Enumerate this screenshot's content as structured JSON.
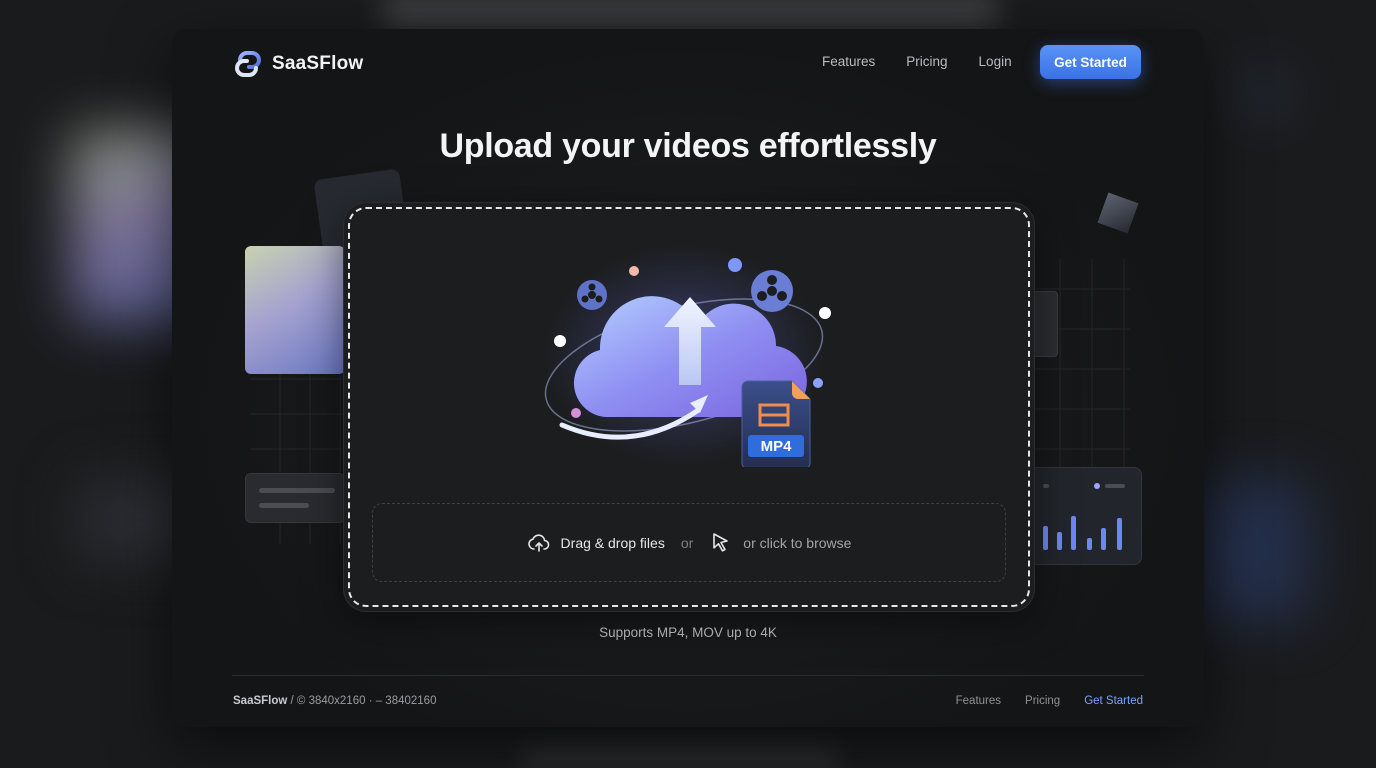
{
  "brand": {
    "name": "SaaSFlow"
  },
  "nav": {
    "links": [
      "Features",
      "Pricing",
      "Login"
    ],
    "cta_label": "Get Started"
  },
  "hero": {
    "title": "Upload your videos effortlessly"
  },
  "upload": {
    "file_badge": "MP4",
    "drop_label": "Drag & drop files",
    "or_label": "or",
    "browse_label": "or click to browse",
    "supports_text": "Supports MP4, MOV up to 4K"
  },
  "footer": {
    "brand": "SaaSFlow",
    "copyright": " / © 3840x2160 · – 38402160",
    "links": [
      "Features",
      "Pricing",
      "Get Started"
    ]
  },
  "colors": {
    "accent": "#3a72e6",
    "accent_light": "#79a3ff",
    "background": "#141516"
  },
  "icons": {
    "logo": "chain-link-logo-icon",
    "upload": "cloud-upload-icon",
    "cursor": "pointer-cursor-icon"
  }
}
